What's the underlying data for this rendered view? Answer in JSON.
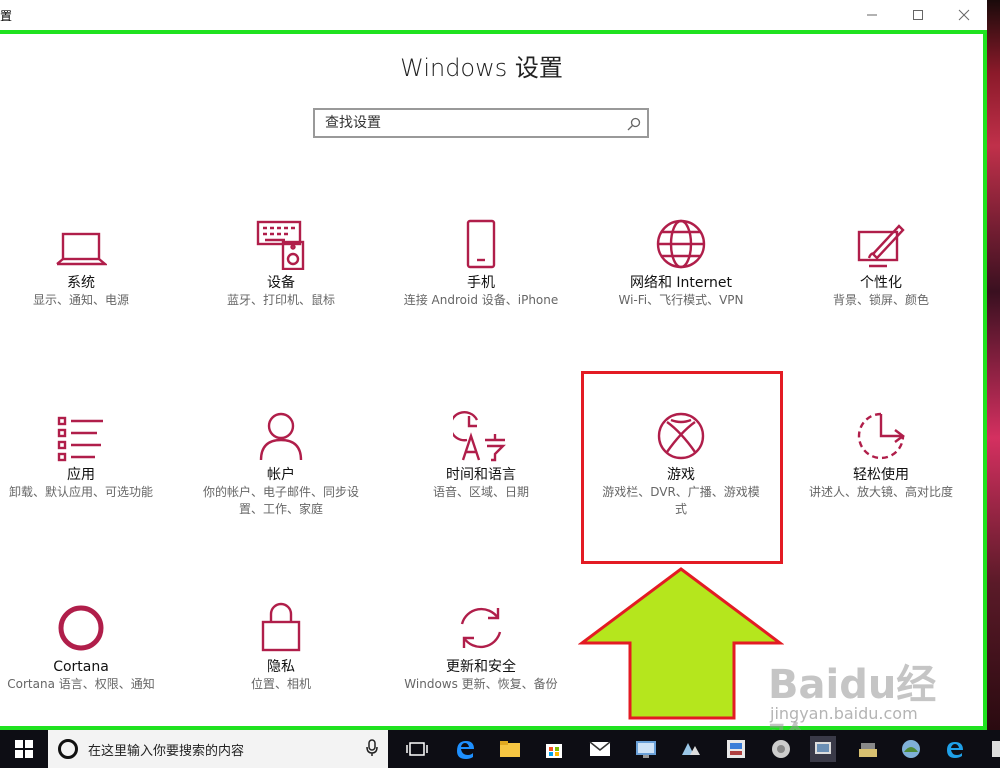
{
  "window": {
    "title": "置",
    "minimize": "minimize",
    "maximize": "maximize",
    "close": "close"
  },
  "heading": "Windows 设置",
  "search": {
    "placeholder": "查找设置"
  },
  "tiles": [
    {
      "name": "系统",
      "desc": "显示、通知、电源",
      "icon": "laptop-icon"
    },
    {
      "name": "设备",
      "desc": "蓝牙、打印机、鼠标",
      "icon": "devices-icon"
    },
    {
      "name": "手机",
      "desc": "连接 Android 设备、iPhone",
      "icon": "phone-icon"
    },
    {
      "name": "网络和 Internet",
      "desc": "Wi-Fi、飞行模式、VPN",
      "icon": "globe-icon"
    },
    {
      "name": "个性化",
      "desc": "背景、锁屏、颜色",
      "icon": "personalize-icon"
    },
    {
      "name": "应用",
      "desc": "卸载、默认应用、可选功能",
      "icon": "apps-list-icon"
    },
    {
      "name": "帐户",
      "desc": "你的帐户、电子邮件、同步设置、工作、家庭",
      "icon": "person-icon"
    },
    {
      "name": "时间和语言",
      "desc": "语音、区域、日期",
      "icon": "time-language-icon"
    },
    {
      "name": "游戏",
      "desc": "游戏栏、DVR、广播、游戏模式",
      "icon": "xbox-icon"
    },
    {
      "name": "轻松使用",
      "desc": "讲述人、放大镜、高对比度",
      "icon": "ease-of-access-icon"
    },
    {
      "name": "Cortana",
      "desc": "Cortana 语言、权限、通知",
      "icon": "cortana-icon"
    },
    {
      "name": "隐私",
      "desc": "位置、相机",
      "icon": "lock-icon"
    },
    {
      "name": "更新和安全",
      "desc": "Windows 更新、恢复、备份",
      "icon": "update-icon"
    }
  ],
  "taskbar": {
    "search_placeholder": "在这里输入你要搜索的内容"
  },
  "watermark": {
    "logo": "Baidu经验",
    "url": "jingyan.baidu.com"
  },
  "colors": {
    "accent": "#b01e4a",
    "highlight_box": "#e31b23",
    "green_frame": "#1fe21f",
    "arrow_fill": "#b5e61d"
  }
}
